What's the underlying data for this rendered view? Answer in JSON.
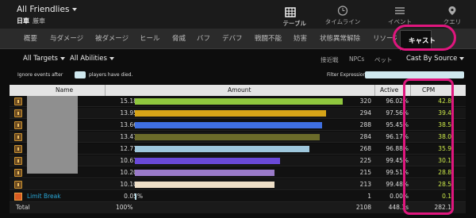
{
  "encounter": {
    "title": "All Friendlies",
    "zone": "日車",
    "difficulty": "厳車"
  },
  "topnav": [
    {
      "label": "テーブル",
      "icon": "table-icon",
      "active": true
    },
    {
      "label": "タイムライン",
      "icon": "timeline-icon",
      "active": false
    },
    {
      "label": "イベント",
      "icon": "events-icon",
      "active": false
    },
    {
      "label": "クエリ",
      "icon": "query-icon",
      "active": false
    }
  ],
  "tabs": [
    "概要",
    "与ダメージ",
    "被ダメージ",
    "ヒール",
    "脅威",
    "バフ",
    "デバフ",
    "戦闘不能",
    "妨害",
    "状態異常解除",
    "リソース",
    "キャスト"
  ],
  "active_tab": "キャスト",
  "filters": {
    "targets": "All Targets",
    "abilities": "All Abilities",
    "options": [
      "接近戦",
      "NPCs",
      "ペット"
    ],
    "view": "Cast By Source"
  },
  "options_row": {
    "ignore_before": "Ignore events after",
    "ignore_after": "players have died.",
    "filter_label": "Filter Expression:"
  },
  "table": {
    "headers": {
      "name": "Name",
      "amount": "Amount",
      "active": "Active",
      "cpm": "CPM"
    },
    "rows": [
      {
        "pct": "15.18%",
        "amount": "320",
        "active": "96.02%",
        "cpm": "42.8",
        "bar_pct": 100,
        "color": "#8fc73e"
      },
      {
        "pct": "13.95%",
        "amount": "294",
        "active": "97.56%",
        "cpm": "39.4",
        "bar_pct": 92,
        "color": "#d6a418"
      },
      {
        "pct": "13.66%",
        "amount": "288",
        "active": "95.45%",
        "cpm": "38.5",
        "bar_pct": 90,
        "color": "#3f6fe0"
      },
      {
        "pct": "13.47%",
        "amount": "284",
        "active": "96.17%",
        "cpm": "38.0",
        "bar_pct": 89,
        "color": "#6b6b2a"
      },
      {
        "pct": "12.71%",
        "amount": "268",
        "active": "96.88%",
        "cpm": "35.9",
        "bar_pct": 84,
        "color": "#9ec7dc"
      },
      {
        "pct": "10.67%",
        "amount": "225",
        "active": "99.45%",
        "cpm": "30.1",
        "bar_pct": 70,
        "color": "#6a49d8"
      },
      {
        "pct": "10.20%",
        "amount": "215",
        "active": "99.51%",
        "cpm": "28.8",
        "bar_pct": 67,
        "color": "#9a7ac8"
      },
      {
        "pct": "10.10%",
        "amount": "213",
        "active": "99.48%",
        "cpm": "28.5",
        "bar_pct": 67,
        "color": "#efe0c8"
      }
    ],
    "limit_break": {
      "name": "Limit Break",
      "pct": "0.05%",
      "amount": "1",
      "active": "0.00%",
      "cpm": "0.1"
    },
    "total": {
      "label": "Total",
      "pct": "100%",
      "amount": "2108",
      "active": "448.3s",
      "cpm": "282.1"
    }
  }
}
